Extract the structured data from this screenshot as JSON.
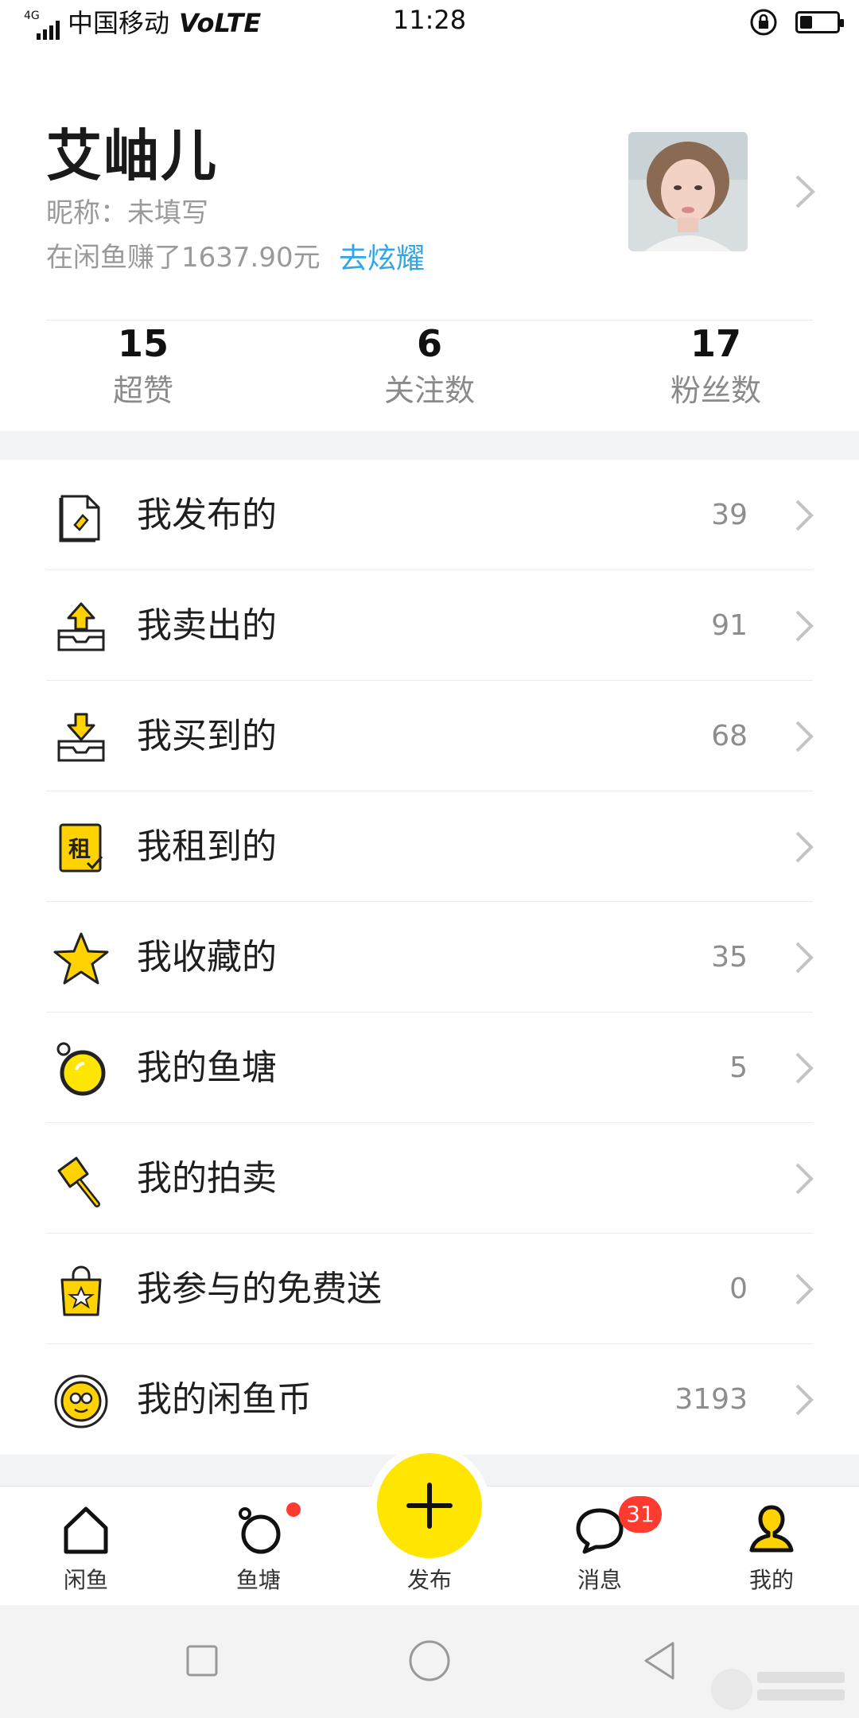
{
  "status_bar": {
    "network_small": "4G",
    "carrier": "中国移动",
    "volte": "VoLTE",
    "time": "11:28",
    "battery_level": 0.35
  },
  "profile": {
    "name": "艾岫儿",
    "nickname": "昵称：未填写",
    "earned": "在闲鱼赚了1637.90元",
    "show_off": "去炫耀"
  },
  "stats": [
    {
      "value": "15",
      "label": "超赞"
    },
    {
      "value": "6",
      "label": "关注数"
    },
    {
      "value": "17",
      "label": "粉丝数"
    }
  ],
  "menu": [
    {
      "label": "我发布的",
      "count": "39",
      "icon": "publish-doc-icon"
    },
    {
      "label": "我卖出的",
      "count": "91",
      "icon": "sold-box-icon"
    },
    {
      "label": "我买到的",
      "count": "68",
      "icon": "bought-box-icon"
    },
    {
      "label": "我租到的",
      "count": "",
      "icon": "rent-icon",
      "icon_char": "租"
    },
    {
      "label": "我收藏的",
      "count": "35",
      "icon": "star-icon"
    },
    {
      "label": "我的鱼塘",
      "count": "5",
      "icon": "pond-icon"
    },
    {
      "label": "我的拍卖",
      "count": "",
      "icon": "auction-hammer-icon"
    },
    {
      "label": "我参与的免费送",
      "count": "0",
      "icon": "gift-bag-icon"
    },
    {
      "label": "我的闲鱼币",
      "count": "3193",
      "icon": "coin-icon"
    }
  ],
  "tabs": [
    {
      "label": "闲鱼",
      "icon": "home-icon"
    },
    {
      "label": "鱼塘",
      "icon": "pond-tab-icon"
    },
    {
      "label": "发布",
      "icon": "plus-icon"
    },
    {
      "label": "消息",
      "icon": "chat-icon",
      "badge": "31"
    },
    {
      "label": "我的",
      "icon": "user-icon"
    }
  ],
  "colors": {
    "accent_yellow": "#ffe600",
    "link_blue": "#2fa6e8",
    "badge_red": "#ff3b30"
  }
}
